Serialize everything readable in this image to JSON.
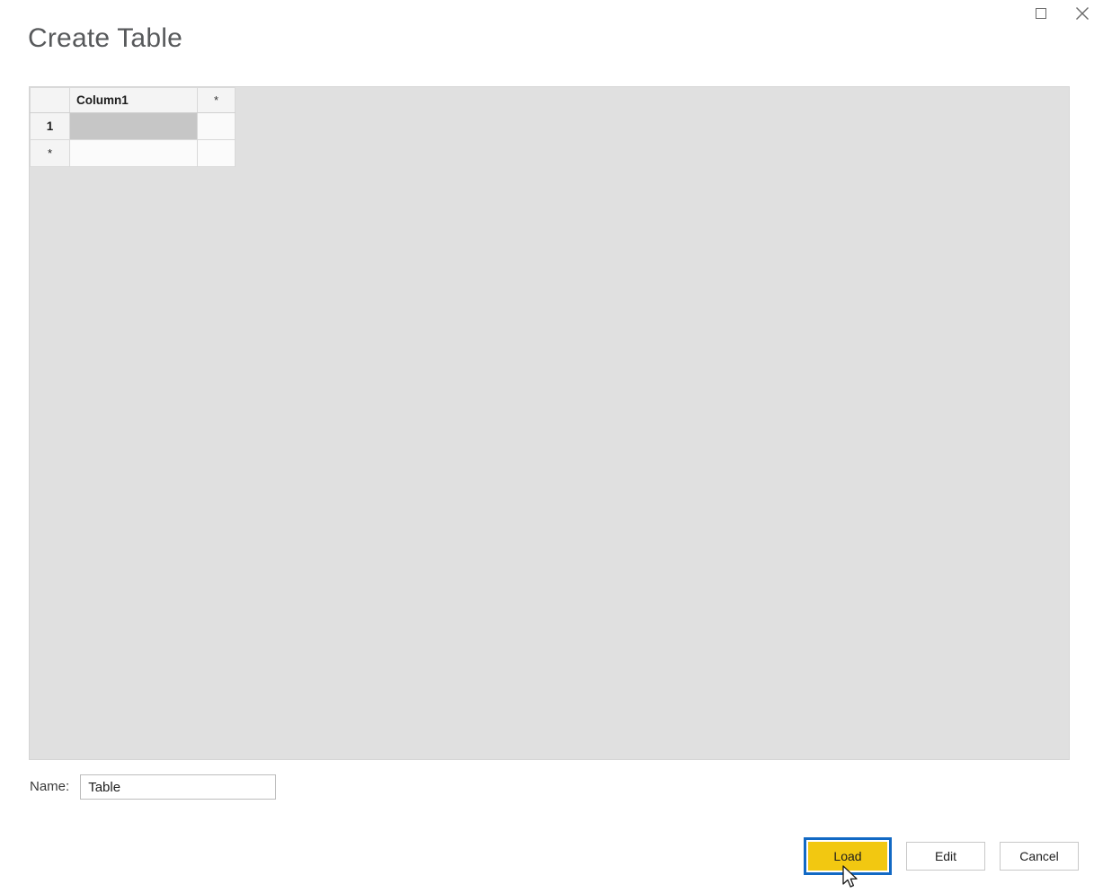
{
  "window": {
    "controls": [
      {
        "name": "maximize",
        "glyph": "square",
        "label": "Maximize"
      },
      {
        "name": "close",
        "glyph": "x",
        "label": "Close"
      }
    ]
  },
  "header": {
    "title": "Create Table"
  },
  "grid": {
    "columns": [
      {
        "key": "rowheader",
        "label": ""
      },
      {
        "key": "column1",
        "label": "Column1"
      },
      {
        "key": "newcolumn",
        "label": "*"
      }
    ],
    "rows": [
      {
        "header": "1",
        "column1": "",
        "newcolumn": "",
        "selected": true
      },
      {
        "header": "*",
        "column1": "",
        "newcolumn": "",
        "selected": false
      }
    ]
  },
  "name_field": {
    "label": "Name:",
    "value": "Table",
    "placeholder": ""
  },
  "footer": {
    "load_label": "Load",
    "edit_label": "Edit",
    "cancel_label": "Cancel"
  },
  "colors": {
    "accent_yellow": "#F2C811",
    "focus_blue": "#1269C4",
    "panel_gray": "#E0E0E0",
    "selected_cell": "#C6C6C6",
    "title_text": "#57595B"
  }
}
